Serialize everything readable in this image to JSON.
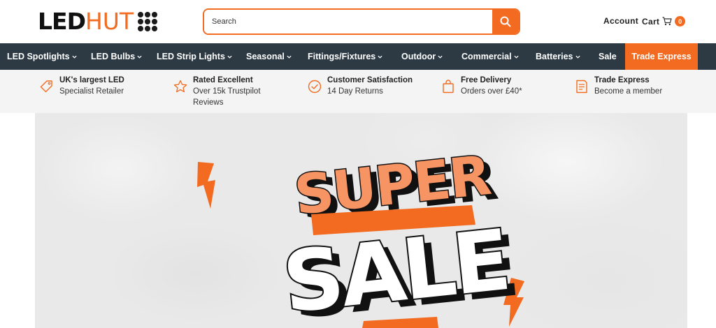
{
  "brand": {
    "logo_part1": "LED",
    "logo_part2": "HUT"
  },
  "search": {
    "placeholder": "Search"
  },
  "header": {
    "account_label": "Account",
    "cart_label": "Cart",
    "cart_count": "0"
  },
  "nav": {
    "items": [
      {
        "label": "LED Spotlights",
        "has_dropdown": true
      },
      {
        "label": "LED Bulbs",
        "has_dropdown": true
      },
      {
        "label": "LED Strip Lights",
        "has_dropdown": true
      },
      {
        "label": "Seasonal",
        "has_dropdown": true
      },
      {
        "label": "Fittings/Fixtures",
        "has_dropdown": true
      },
      {
        "label": "Outdoor",
        "has_dropdown": true
      },
      {
        "label": "Commercial",
        "has_dropdown": true
      },
      {
        "label": "Batteries",
        "has_dropdown": true
      },
      {
        "label": "Sale",
        "has_dropdown": false
      },
      {
        "label": "Trade Express",
        "has_dropdown": false
      }
    ]
  },
  "usps": [
    {
      "icon": "tag-icon",
      "title": "UK's largest LED",
      "line1": "Specialist Retailer",
      "line2": ""
    },
    {
      "icon": "star-icon",
      "title": "Rated Excellent",
      "line1": "Over 15k Trustpilot",
      "line2": "Reviews"
    },
    {
      "icon": "check-circle-icon",
      "title": "Customer Satisfaction",
      "line1": "14 Day Returns",
      "line2": ""
    },
    {
      "icon": "shopping-bag-icon",
      "title": "Free Delivery",
      "line1": "Orders over £40*",
      "line2": ""
    },
    {
      "icon": "document-icon",
      "title": "Trade Express",
      "line1": "Become a member",
      "line2": ""
    }
  ],
  "hero": {
    "line1": "SUPER",
    "line2": "SALE"
  },
  "colors": {
    "accent": "#f26b21",
    "nav_bg": "#2d3a44",
    "usp_bg": "#f4f4f4",
    "super_fill": "#f79463"
  }
}
